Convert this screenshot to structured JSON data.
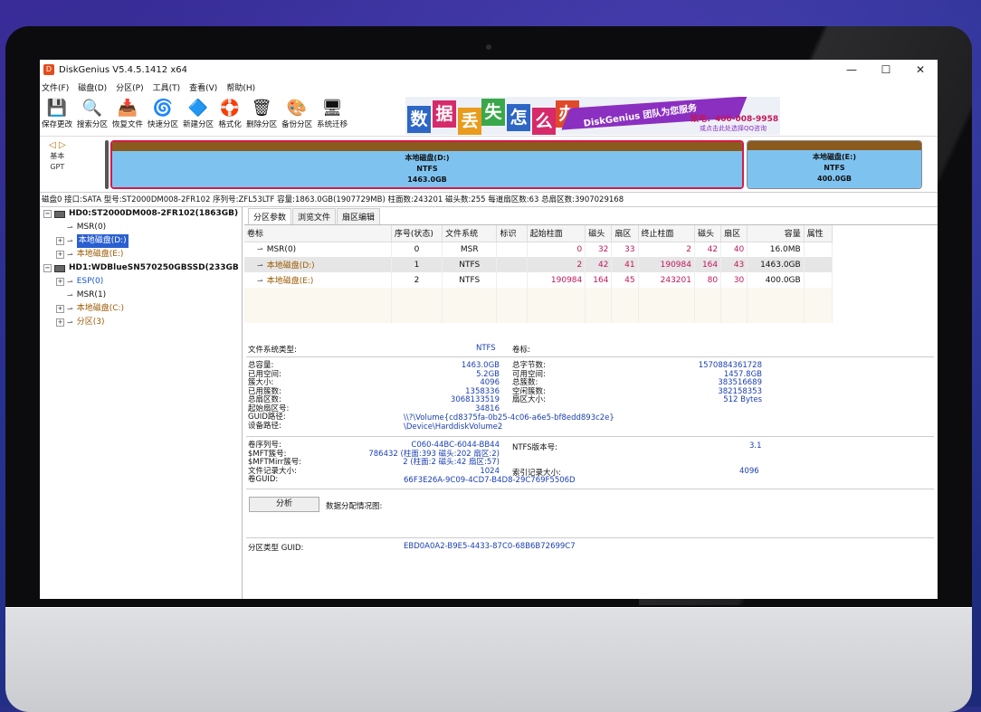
{
  "window": {
    "title": "DiskGenius V5.4.5.1412 x64",
    "min": "—",
    "max": "☐",
    "close": "✕"
  },
  "menu": [
    "文件(F)",
    "磁盘(D)",
    "分区(P)",
    "工具(T)",
    "查看(V)",
    "帮助(H)"
  ],
  "toolbar": [
    {
      "label": "保存更改",
      "icon": "save-icon",
      "glyph": "💾"
    },
    {
      "label": "搜索分区",
      "icon": "search-icon",
      "glyph": "🔍"
    },
    {
      "label": "恢复文件",
      "icon": "recover-icon",
      "glyph": "📥"
    },
    {
      "label": "快速分区",
      "icon": "quick-partition-icon",
      "glyph": "🌀"
    },
    {
      "label": "新建分区",
      "icon": "new-partition-icon",
      "glyph": "🔷"
    },
    {
      "label": "格式化",
      "icon": "format-icon",
      "glyph": "🛟"
    },
    {
      "label": "删除分区",
      "icon": "delete-icon",
      "glyph": "🗑"
    },
    {
      "label": "备份分区",
      "icon": "backup-icon",
      "glyph": "🎨"
    },
    {
      "label": "系统迁移",
      "icon": "migrate-icon",
      "glyph": "🖥"
    }
  ],
  "banner": {
    "chars": [
      "数",
      "据",
      "丢",
      "失",
      "怎",
      "么",
      "办"
    ],
    "slogan": "DiskGenius 团队为您服务",
    "phone": "致电：400-008-9958",
    "qq": "或点击此处选择QQ咨询"
  },
  "diskmap": {
    "nav": "◁ ▷",
    "type1": "基本",
    "type2": "GPT",
    "parts": [
      {
        "name": "本地磁盘(D:)",
        "fs": "NTFS",
        "size": "1463.0GB"
      },
      {
        "name": "本地磁盘(E:)",
        "fs": "NTFS",
        "size": "400.0GB"
      }
    ]
  },
  "diskinfo": "磁盘0 接口:SATA  型号:ST2000DM008-2FR102  序列号:ZFL53LTF  容量:1863.0GB(1907729MB)  柱面数:243201  磁头数:255  每道扇区数:63  总扇区数:3907029168",
  "tree": [
    {
      "label": "HD0:ST2000DM008-2FR102(1863GB)",
      "level": 0,
      "kind": "disk"
    },
    {
      "label": "MSR(0)",
      "level": 1,
      "kind": "part"
    },
    {
      "label": "本地磁盘(D:)",
      "level": 1,
      "kind": "sel"
    },
    {
      "label": "本地磁盘(E:)",
      "level": 1,
      "kind": "brown"
    },
    {
      "label": "HD1:WDBlueSN570250GBSSD(233GB",
      "level": 0,
      "kind": "disk"
    },
    {
      "label": "ESP(0)",
      "level": 1,
      "kind": "blue"
    },
    {
      "label": "MSR(1)",
      "level": 1,
      "kind": "part"
    },
    {
      "label": "本地磁盘(C:)",
      "level": 1,
      "kind": "brown"
    },
    {
      "label": "分区(3)",
      "level": 1,
      "kind": "brown"
    }
  ],
  "tabs": [
    "分区参数",
    "浏览文件",
    "扇区编辑"
  ],
  "table": {
    "headers": [
      "卷标",
      "序号(状态)",
      "文件系统",
      "标识",
      "起始柱面",
      "磁头",
      "扇区",
      "终止柱面",
      "磁头",
      "扇区",
      "容量",
      "属性"
    ],
    "rows": [
      [
        "MSR(0)",
        "0",
        "MSR",
        "",
        "0",
        "32",
        "33",
        "2",
        "42",
        "40",
        "16.0MB",
        ""
      ],
      [
        "本地磁盘(D:)",
        "1",
        "NTFS",
        "",
        "2",
        "42",
        "41",
        "190984",
        "164",
        "43",
        "1463.0GB",
        ""
      ],
      [
        "本地磁盘(E:)",
        "2",
        "NTFS",
        "",
        "190984",
        "164",
        "45",
        "243201",
        "80",
        "30",
        "400.0GB",
        ""
      ]
    ]
  },
  "details": {
    "fs_type_label": "文件系统类型:",
    "fs_type": "NTFS",
    "vol_label": "卷标:",
    "left1": [
      "总容量:",
      "已用空间:",
      "簇大小:",
      "已用簇数:",
      "总扇区数:",
      "起始扇区号:",
      "GUID路径:",
      "设备路径:"
    ],
    "val1": [
      "1463.0GB",
      "5.2GB",
      "4096",
      "1358336",
      "3068133519",
      "34816"
    ],
    "mid1": [
      "总字节数:",
      "可用空间:",
      "总簇数:",
      "空闲簇数:",
      "扇区大小:"
    ],
    "val2": [
      "1570884361728",
      "1457.8GB",
      "383516689",
      "382158353",
      "512 Bytes"
    ],
    "guid_path": "\\\\?\\Volume{cd8375fa-0b25-4c06-a6e5-bf8edd893c2e}",
    "device_path": "\\Device\\HarddiskVolume2",
    "left2": [
      "卷序列号:",
      "$MFT簇号:",
      "$MFTMirr簇号:",
      "文件记录大小:",
      "卷GUID:"
    ],
    "val3": [
      "C060-44BC-6044-BB44",
      "786432 (柱面:393 磁头:202 扇区:2)",
      "2 (柱面:2 磁头:42 扇区:57)",
      "1024",
      "66F3E26A-9C09-4CD7-B4D8-29C769F5506D"
    ],
    "ntfs_ver_label": "NTFS版本号:",
    "ntfs_ver": "3.1",
    "index_label": "索引记录大小:",
    "index_size": "4096",
    "analyze": "分析",
    "alloc_label": "数据分配情况图:",
    "type_guid_label": "分区类型 GUID:",
    "type_guid": "EBD0A0A2-B9E5-4433-87C0-68B6B72699C7"
  }
}
